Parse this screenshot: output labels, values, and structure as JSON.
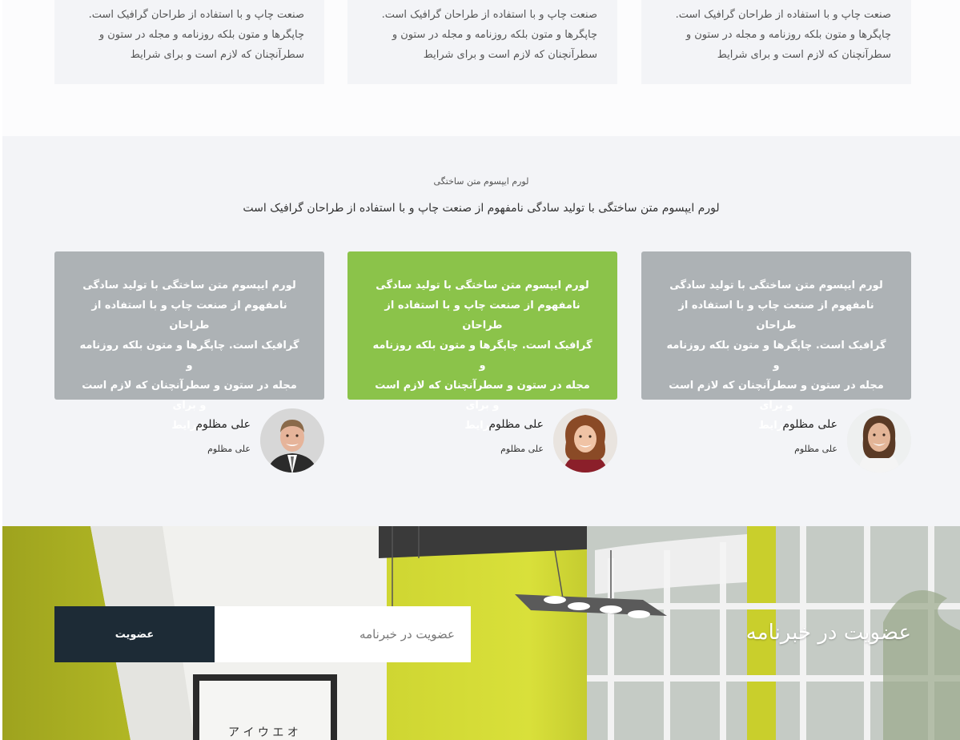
{
  "top_cards": [
    {
      "lines": [
        "صنعت چاپ و با استفاده از طراحان گرافیک است.",
        "چاپگرها و متون بلکه روزنامه و مجله در ستون و",
        "سطرآنچنان که لازم است و برای شرایط"
      ]
    },
    {
      "lines": [
        "صنعت چاپ و با استفاده از طراحان گرافیک است.",
        "چاپگرها و متون بلکه روزنامه و مجله در ستون و",
        "سطرآنچنان که لازم است و برای شرایط"
      ]
    },
    {
      "lines": [
        "صنعت چاپ و با استفاده از طراحان گرافیک است.",
        "چاپگرها و متون بلکه روزنامه و مجله در ستون و",
        "سطرآنچنان که لازم است و برای شرایط"
      ]
    }
  ],
  "testimonials": {
    "kicker": "لورم ایپسوم متن ساختگی",
    "title": "لورم ایپسوم متن ساختگی با تولید سادگی نامفهوم از صنعت چاپ و با استفاده از طراحان گرافیک است",
    "items": [
      {
        "quote_lines": [
          "لورم ایپسوم متن ساختگی با تولید سادگی",
          "نامفهوم از صنعت چاپ و با استفاده از طراحان",
          "گرافیک است. چاپگرها و متون بلکه روزنامه و",
          "مجله در ستون و سطرآنچنان که لازم است و برای",
          "شرایط"
        ],
        "name": "علی مظلوم",
        "role": "علی مظلوم",
        "avatar": "woman-avatar",
        "active": false
      },
      {
        "quote_lines": [
          "لورم ایپسوم متن ساختگی با تولید سادگی",
          "نامفهوم از صنعت چاپ و با استفاده از طراحان",
          "گرافیک است. چاپگرها و متون بلکه روزنامه و",
          "مجله در ستون و سطرآنچنان که لازم است و برای",
          "شرایط"
        ],
        "name": "علی مظلوم",
        "role": "علی مظلوم",
        "avatar": "woman-curly-avatar",
        "active": true
      },
      {
        "quote_lines": [
          "لورم ایپسوم متن ساختگی با تولید سادگی",
          "نامفهوم از صنعت چاپ و با استفاده از طراحان",
          "گرافیک است. چاپگرها و متون بلکه روزنامه و",
          "مجله در ستون و سطرآنچنان که لازم است و برای",
          "شرایط"
        ],
        "name": "علی مظلوم",
        "role": "علی مظلوم",
        "avatar": "man-avatar",
        "active": false
      }
    ]
  },
  "newsletter": {
    "title": "عضویت در خبرنامه",
    "input_placeholder": "عضویت در خبرنامه",
    "button_label": "عضویت"
  },
  "colors": {
    "active_quote": "#8bc34a",
    "inactive_quote": "#adb2b5",
    "button": "#1d2b36",
    "section_bg": "#f3f4f7"
  }
}
